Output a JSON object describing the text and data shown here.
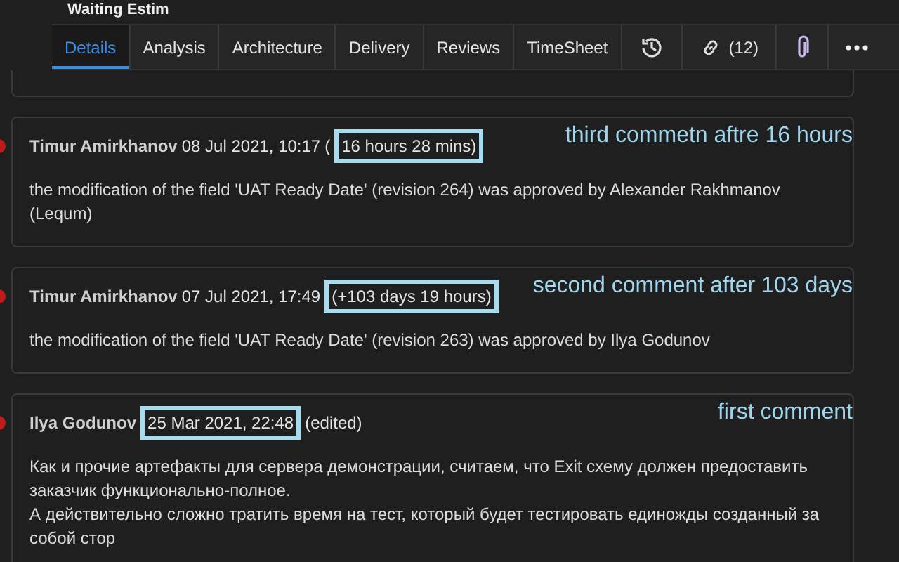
{
  "header": {
    "title": "Waiting Estim"
  },
  "tabs": [
    {
      "kind": "text",
      "label": "Details",
      "selected": true
    },
    {
      "kind": "text",
      "label": "Analysis",
      "selected": false
    },
    {
      "kind": "text",
      "label": "Architecture",
      "selected": false
    },
    {
      "kind": "text",
      "label": "Delivery",
      "selected": false
    },
    {
      "kind": "text",
      "label": "Reviews",
      "selected": false
    },
    {
      "kind": "text",
      "label": "TimeSheet",
      "selected": false
    },
    {
      "kind": "history",
      "selected": false
    },
    {
      "kind": "links",
      "label": "(12)",
      "selected": false
    },
    {
      "kind": "attachments",
      "selected": false
    },
    {
      "kind": "more",
      "selected": false
    }
  ],
  "comments": [
    {
      "author": "Timur Amirkhanov",
      "date": "08 Jul 2021, 10:17",
      "prefix": "(",
      "elapsed": "16 hours 28 mins)",
      "date_highlighted": false,
      "elapsed_highlighted": true,
      "annotation": "third commetn aftre 16 hours",
      "body": [
        "the modification of the field 'UAT Ready Date' (revision 264) was approved by Alexander Rakhmanov (Lequm)"
      ]
    },
    {
      "author": "Timur Amirkhanov",
      "date": "07 Jul 2021, 17:49",
      "elapsed": "(+103 days 19 hours)",
      "date_highlighted": false,
      "elapsed_highlighted": true,
      "annotation": "second comment after 103 days",
      "body": [
        "the modification of the field 'UAT Ready Date' (revision 263) was approved by Ilya Godunov"
      ]
    },
    {
      "author": "Ilya Godunov",
      "date": "25 Mar 2021, 22:48",
      "suffix": "(edited)",
      "date_highlighted": true,
      "annotation": "first comment",
      "body": [
        "Как и прочие артефакты для сервера демонстрации, считаем, что Exit схему должен предоставить заказчик функционально-полное.",
        "А действительно сложно тратить время на тест, который будет тестировать единожды созданный за собой стор"
      ]
    }
  ]
}
